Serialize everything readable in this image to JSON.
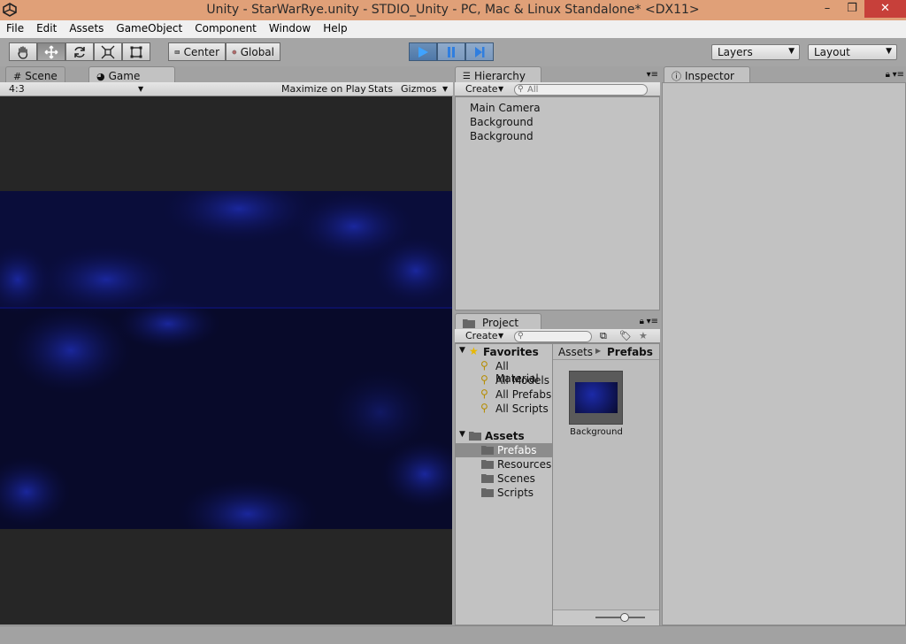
{
  "window": {
    "title": "Unity - StarWarRye.unity - STDIO_Unity - PC, Mac & Linux Standalone* <DX11>",
    "minimize": "–",
    "restore": "❐",
    "close": "✕"
  },
  "menu": [
    "File",
    "Edit",
    "Assets",
    "GameObject",
    "Component",
    "Window",
    "Help"
  ],
  "toolbar": {
    "pivot_label": "Center",
    "space_label": "Global",
    "layers_label": "Layers",
    "layout_label": "Layout"
  },
  "game_view": {
    "scene_tab": "Scene",
    "game_tab": "Game",
    "aspect": "4:3",
    "maximize_label": "Maximize on Play",
    "stats_label": "Stats",
    "gizmos_label": "Gizmos"
  },
  "hierarchy": {
    "tab": "Hierarchy",
    "create_label": "Create",
    "search_placeholder": "All",
    "items": [
      "Main Camera",
      "Background",
      "Background"
    ]
  },
  "project": {
    "tab": "Project",
    "create_label": "Create",
    "favorites_label": "Favorites",
    "favorites": [
      "All Material",
      "All Models",
      "All Prefabs",
      "All Scripts"
    ],
    "assets_label": "Assets",
    "folders": [
      "Prefabs",
      "Resources",
      "Scenes",
      "Scripts"
    ],
    "breadcrumb": [
      "Assets",
      "Prefabs"
    ],
    "asset_name": "Background"
  },
  "inspector": {
    "tab": "Inspector"
  },
  "colors": {
    "accent_play": "#4f78a8",
    "titlebar": "#e0a078",
    "selected_folder": "#8c8c8c",
    "game_bg": "#262626",
    "space_dark": "#080a28"
  }
}
